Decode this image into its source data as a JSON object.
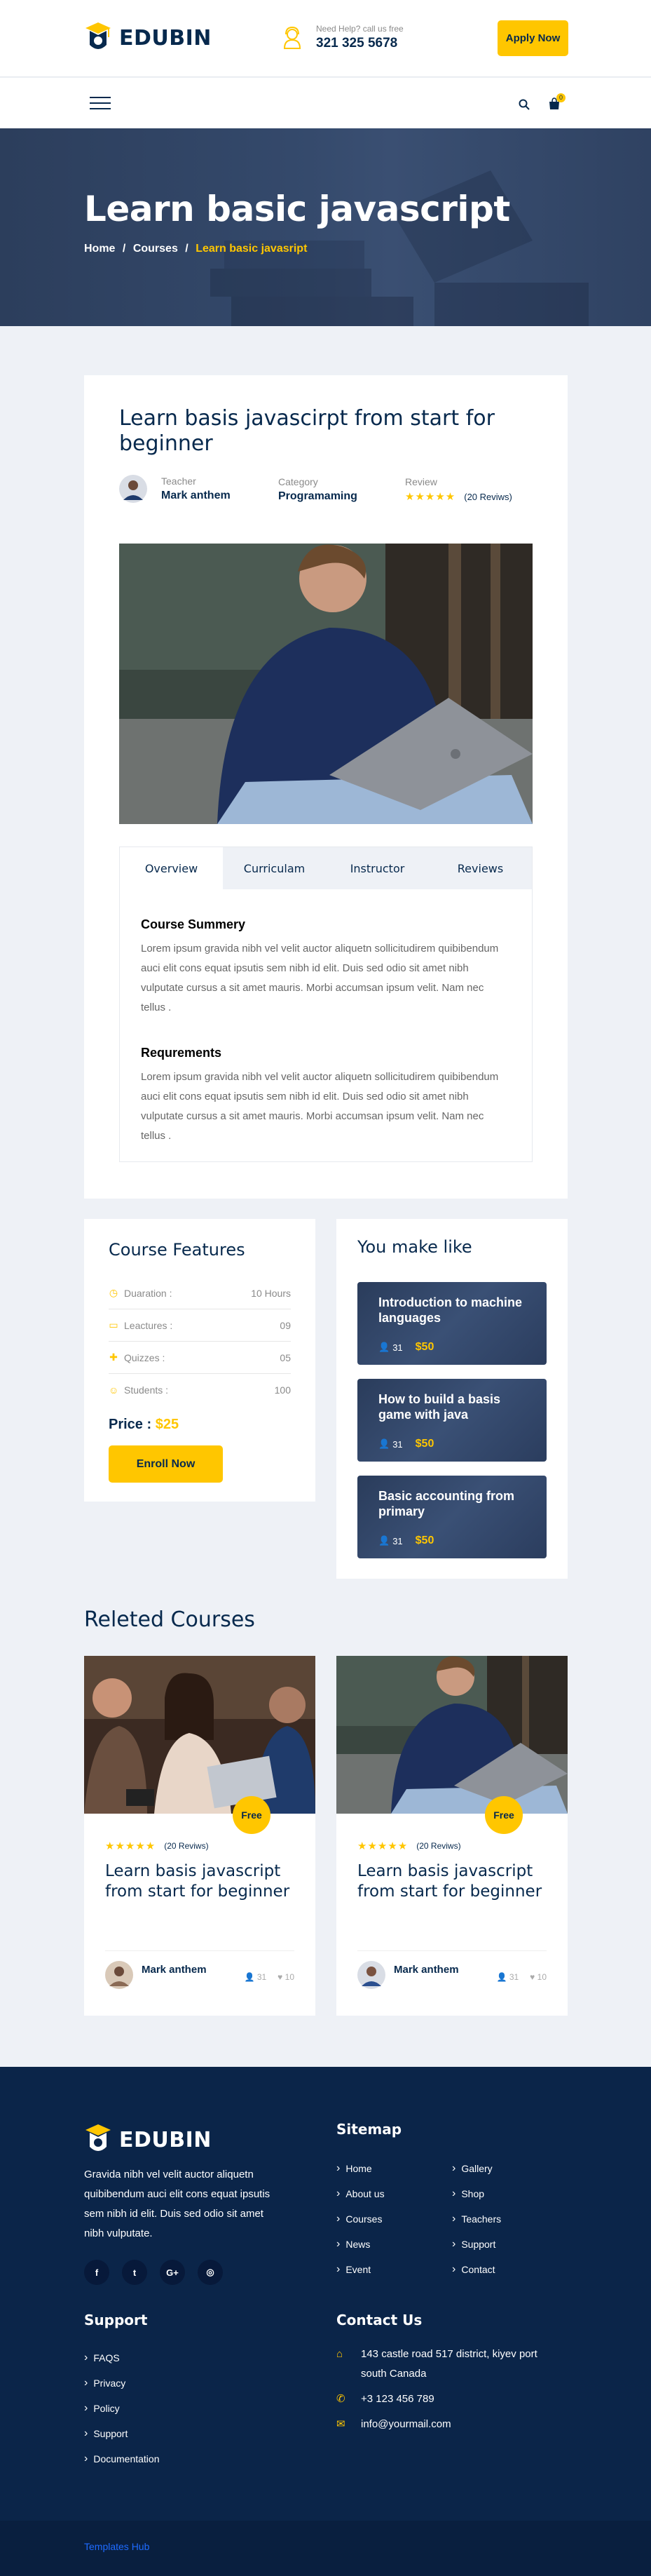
{
  "header": {
    "logo": "EDUBIN",
    "help_label": "Need Help? call us free",
    "phone": "321 325 5678",
    "apply_label": "Apply Now",
    "cart_count": "0"
  },
  "hero": {
    "title": "Learn basic javascript",
    "breadcrumb": {
      "home": "Home",
      "sep1": "/",
      "courses": "Courses",
      "sep2": "/",
      "current": "Learn basic javasript"
    }
  },
  "course": {
    "title": "Learn basis javascirpt from start for beginner",
    "teacher_label": "Teacher",
    "teacher_name": "Mark anthem",
    "category_label": "Category",
    "category_value": "Programaming",
    "review_label": "Review",
    "review_stars": "★★★★★",
    "review_count": "(20 Reviws)",
    "tabs": [
      "Overview",
      "Curriculam",
      "Instructor",
      "Reviews"
    ],
    "summary_heading": "Course Summery",
    "summary_text": "Lorem ipsum gravida nibh vel velit auctor aliquetn sollicitudirem quibibendum auci elit cons equat ipsutis sem nibh id elit. Duis sed odio sit amet nibh vulputate cursus a sit amet mauris. Morbi accumsan ipsum velit. Nam nec tellus .",
    "requirements_heading": "Requrements",
    "requirements_text": "Lorem ipsum gravida nibh vel velit auctor aliquetn sollicitudirem quibibendum auci elit cons equat ipsutis sem nibh id elit. Duis sed odio sit amet nibh vulputate cursus a sit amet mauris. Morbi accumsan ipsum velit. Nam nec tellus ."
  },
  "features": {
    "title": "Course Features",
    "rows": [
      {
        "label": "Duaration :",
        "value": "10 Hours",
        "icon": "clock-icon"
      },
      {
        "label": "Leactures :",
        "value": "09",
        "icon": "file-icon"
      },
      {
        "label": "Quizzes :",
        "value": "05",
        "icon": "puzzle-icon"
      },
      {
        "label": "Students :",
        "value": "100",
        "icon": "user-icon"
      }
    ],
    "price_label": "Price :",
    "price_value": "$25",
    "enroll_label": "Enroll Now"
  },
  "like": {
    "title": "You make like",
    "items": [
      {
        "title": "Introduction to machine languages",
        "students": "31",
        "price": "$50"
      },
      {
        "title": "How to build a basis game with java",
        "students": "31",
        "price": "$50"
      },
      {
        "title": "Basic accounting from primary",
        "students": "31",
        "price": "$50"
      }
    ]
  },
  "related": {
    "title": "Releted Courses",
    "cards": [
      {
        "badge": "Free",
        "stars": "★★★★★",
        "reviews": "(20 Reviws)",
        "title": "Learn basis javascript from start for beginner",
        "author": "Mark anthem",
        "students": "31",
        "likes": "10"
      },
      {
        "badge": "Free",
        "stars": "★★★★★",
        "reviews": "(20 Reviws)",
        "title": "Learn basis javascript from start for beginner",
        "author": "Mark anthem",
        "students": "31",
        "likes": "10"
      }
    ]
  },
  "footer": {
    "logo": "EDUBIN",
    "about": "Gravida nibh vel velit auctor aliquetn quibibendum auci elit cons equat ipsutis sem nibh id elit. Duis sed odio sit amet nibh vulputate.",
    "social": [
      "f",
      "t",
      "G+",
      "◎"
    ],
    "sitemap_title": "Sitemap",
    "sitemap_col1": [
      "Home",
      "About us",
      "Courses",
      "News",
      "Event"
    ],
    "sitemap_col2": [
      "Gallery",
      "Shop",
      "Teachers",
      "Support",
      "Contact"
    ],
    "support_title": "Support",
    "support_links": [
      "FAQS",
      "Privacy",
      "Policy",
      "Support",
      "Documentation"
    ],
    "contact_title": "Contact Us",
    "address": "143 castle road 517 district, kiyev port south Canada",
    "phone": "+3 123 456 789",
    "email": "info@yourmail.com",
    "copyright": "Templates Hub"
  },
  "colors": {
    "accent": "#ffc600",
    "navy": "#07294d",
    "footer": "#0b2549"
  }
}
